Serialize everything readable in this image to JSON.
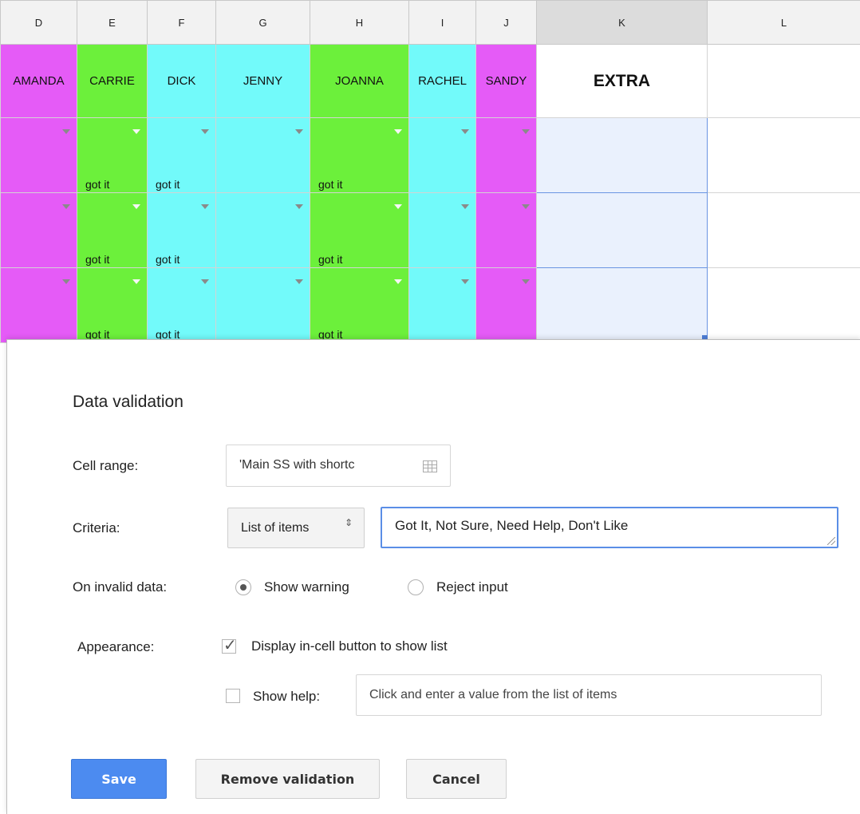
{
  "sheet": {
    "columns": [
      "D",
      "E",
      "F",
      "G",
      "H",
      "I",
      "J",
      "K",
      "L"
    ],
    "selected_column": "K",
    "names": [
      "AMANDA",
      "CARRIE",
      "DICK",
      "JENNY",
      "JOANNA",
      "RACHEL",
      "SANDY",
      "EXTRA",
      ""
    ],
    "cell_value": "got it",
    "colors": {
      "magenta": "#e55bf7",
      "green": "#6cf03b",
      "cyan": "#72fafa",
      "selection": "#eaf1fd",
      "selection_border": "#6a95e2"
    }
  },
  "dialog": {
    "title": "Data validation",
    "cell_range": {
      "label": "Cell range:",
      "value": "'Main SS with shortc",
      "icon": "grid-icon"
    },
    "criteria": {
      "label": "Criteria:",
      "selected": "List of items",
      "arrows": "⇕",
      "items_value": "Got It, Not Sure, Need Help, Don't Like"
    },
    "invalid_data": {
      "label": "On invalid data:",
      "option_warning": "Show warning",
      "option_reject": "Reject input",
      "selected": "Show warning"
    },
    "appearance": {
      "label": "Appearance:",
      "display_button_label": "Display in-cell button to show list",
      "display_button_checked": true,
      "show_help_label": "Show help:",
      "show_help_checked": false,
      "help_text": "Click and enter a value from the list of items"
    },
    "buttons": {
      "save": "Save",
      "remove": "Remove validation",
      "cancel": "Cancel"
    },
    "accent_color": "#4c8bf0"
  }
}
